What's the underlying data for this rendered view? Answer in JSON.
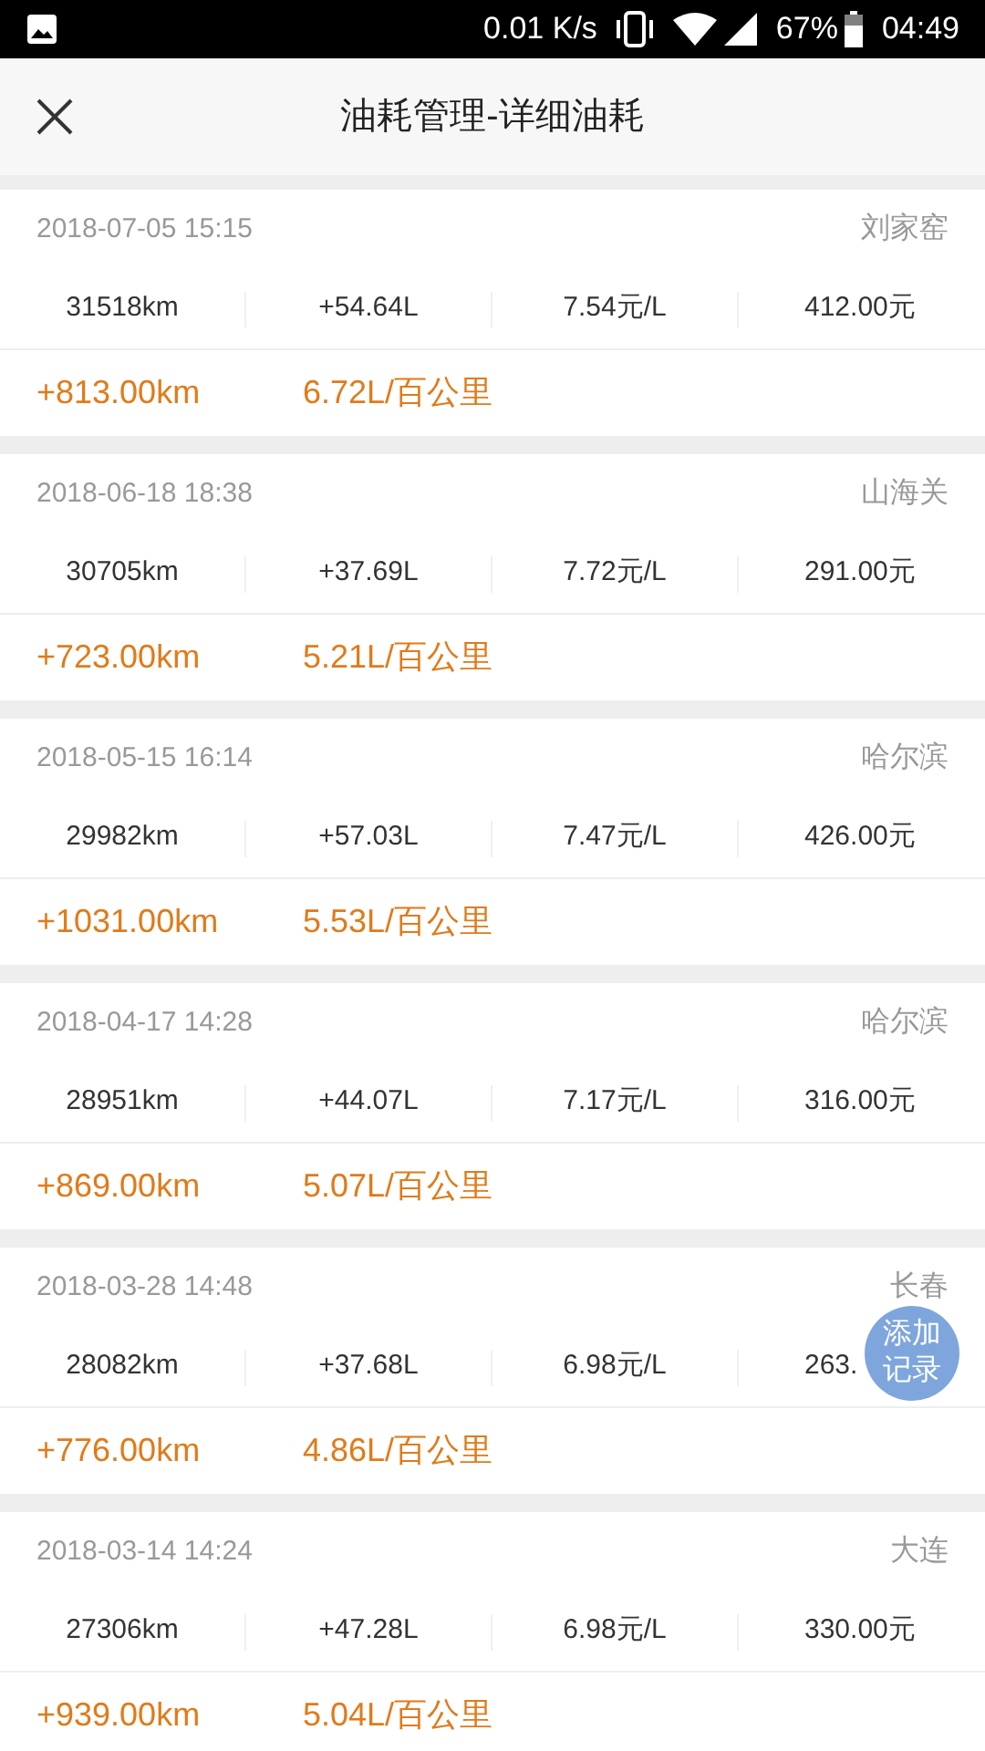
{
  "status_bar": {
    "speed": "0.01 K/s",
    "battery": "67%",
    "time": "04:49"
  },
  "header": {
    "title": "油耗管理-详细油耗"
  },
  "records": [
    {
      "datetime": "2018-07-05 15:15",
      "place": "刘家窑",
      "odometer": "31518km",
      "fuel": "+54.64L",
      "price": "7.54元/L",
      "cost": "412.00元",
      "distance": "+813.00km",
      "consumption": "6.72L/百公里"
    },
    {
      "datetime": "2018-06-18 18:38",
      "place": "山海关",
      "odometer": "30705km",
      "fuel": "+37.69L",
      "price": "7.72元/L",
      "cost": "291.00元",
      "distance": "+723.00km",
      "consumption": "5.21L/百公里"
    },
    {
      "datetime": "2018-05-15 16:14",
      "place": "哈尔滨",
      "odometer": "29982km",
      "fuel": "+57.03L",
      "price": "7.47元/L",
      "cost": "426.00元",
      "distance": "+1031.00km",
      "consumption": "5.53L/百公里"
    },
    {
      "datetime": "2018-04-17 14:28",
      "place": "哈尔滨",
      "odometer": "28951km",
      "fuel": "+44.07L",
      "price": "7.17元/L",
      "cost": "316.00元",
      "distance": "+869.00km",
      "consumption": "5.07L/百公里"
    },
    {
      "datetime": "2018-03-28 14:48",
      "place": "长春",
      "odometer": "28082km",
      "fuel": "+37.68L",
      "price": "6.98元/L",
      "cost": "263.",
      "distance": "+776.00km",
      "consumption": "4.86L/百公里"
    },
    {
      "datetime": "2018-03-14 14:24",
      "place": "大连",
      "odometer": "27306km",
      "fuel": "+47.28L",
      "price": "6.98元/L",
      "cost": "330.00元",
      "distance": "+939.00km",
      "consumption": "5.04L/百公里"
    }
  ],
  "fab": {
    "label": "添加记录"
  }
}
